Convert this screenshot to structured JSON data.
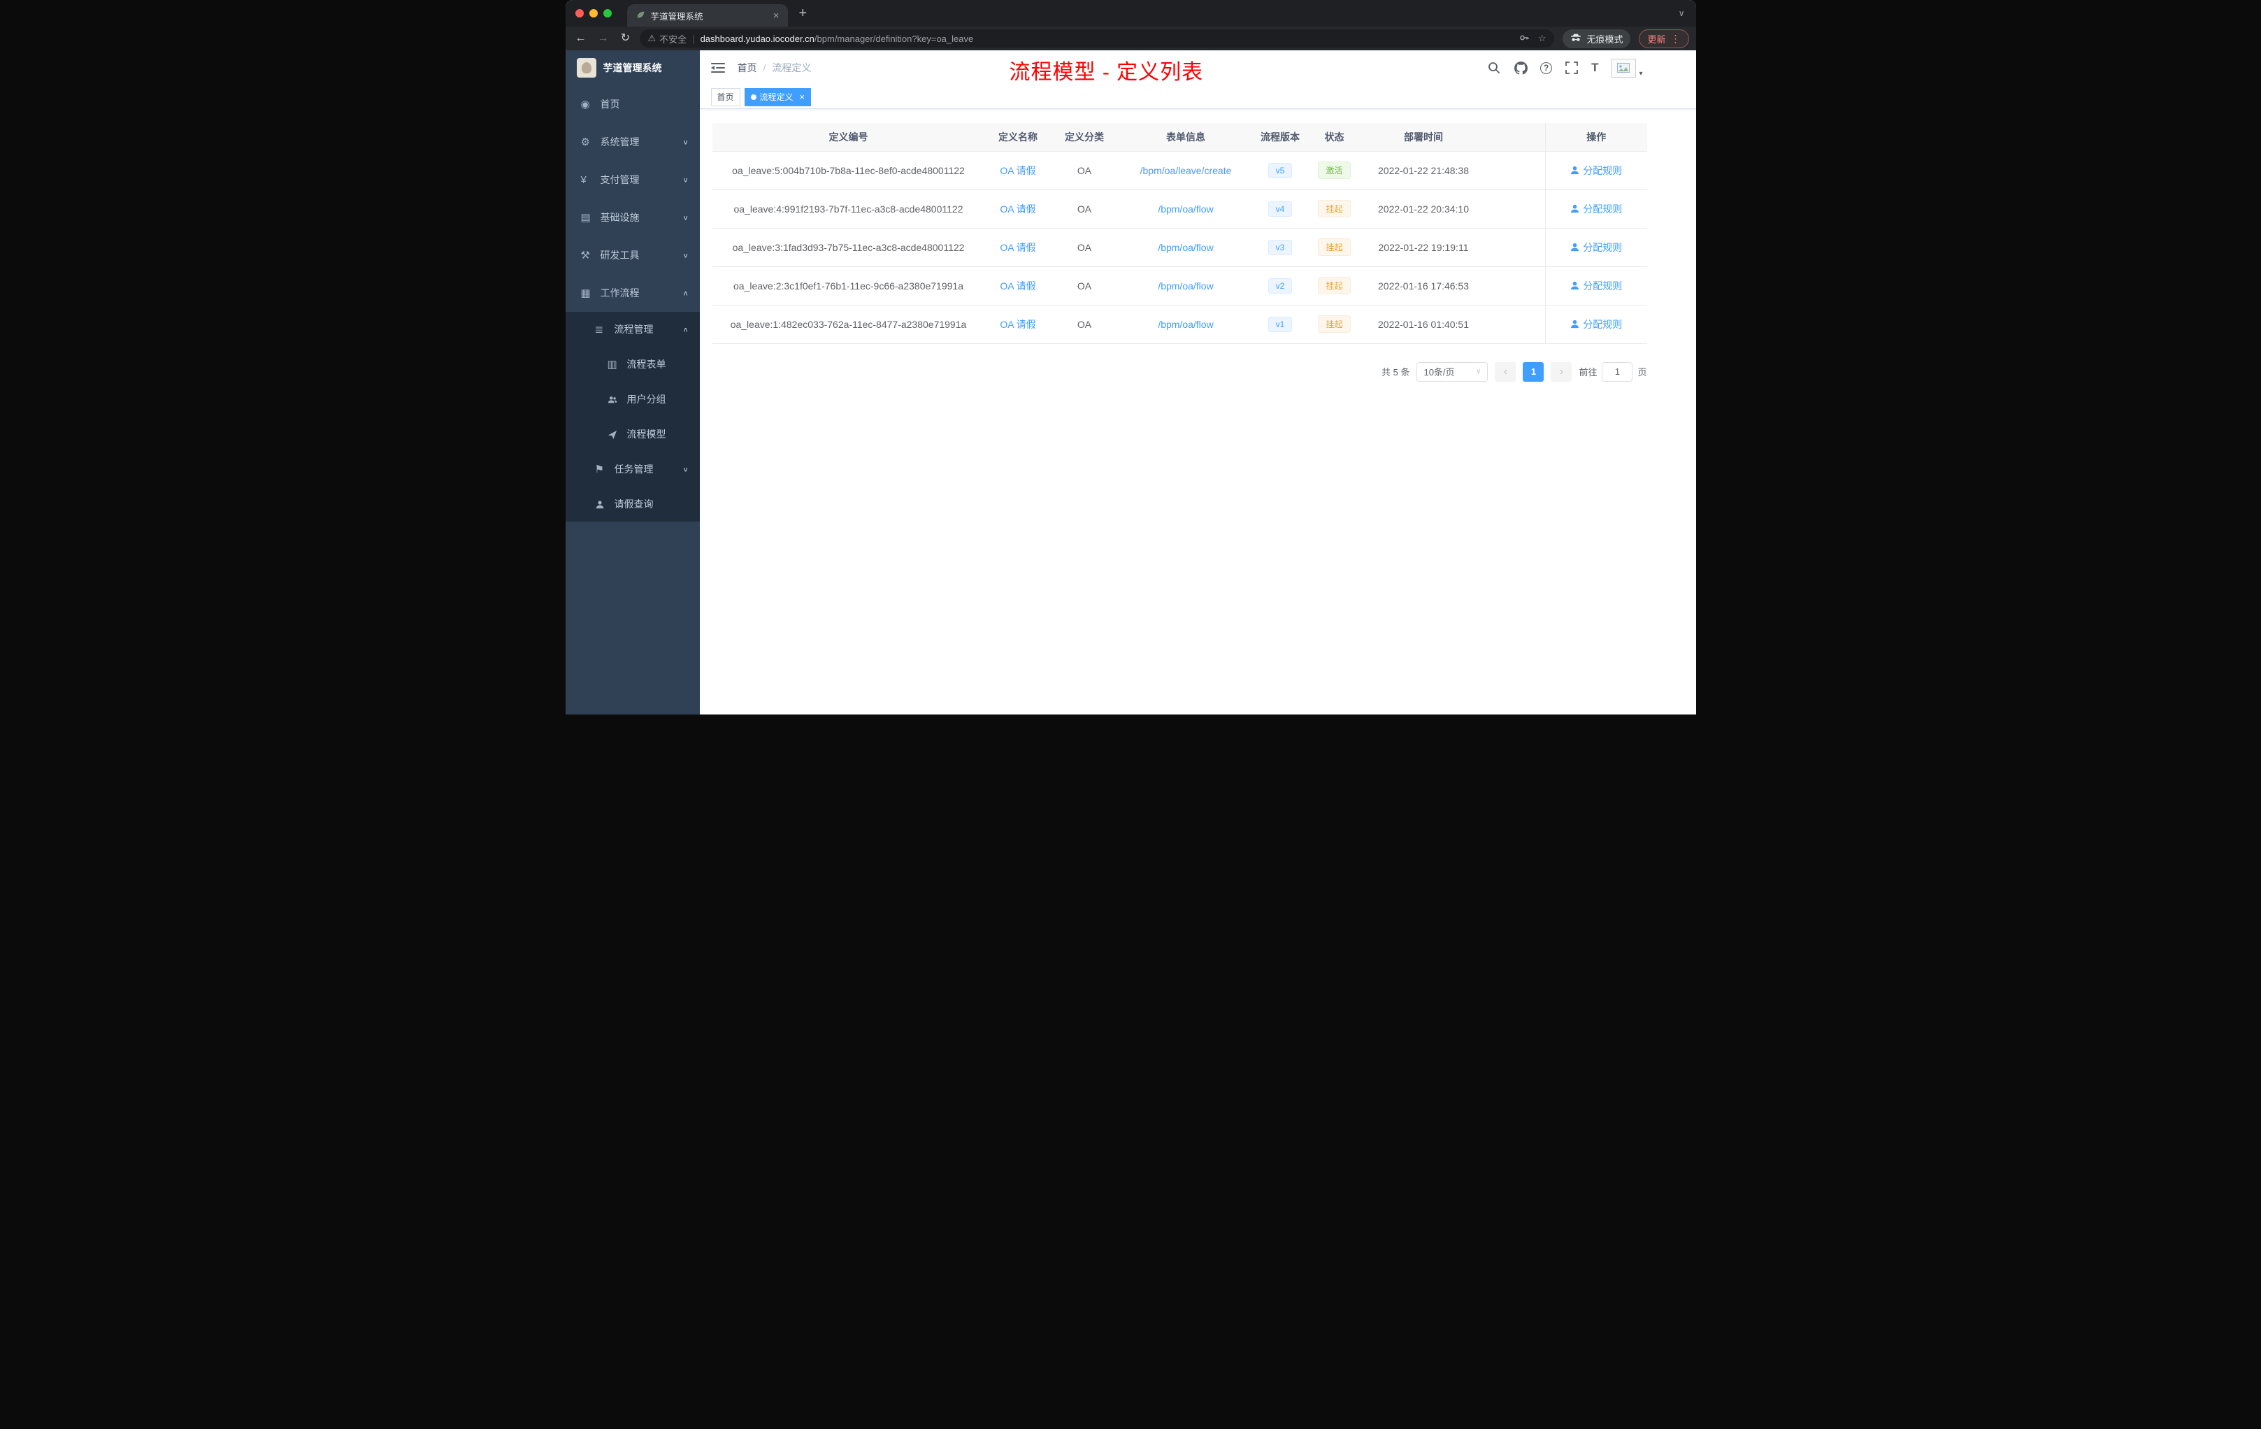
{
  "browser": {
    "tab_title": "芋道管理系统",
    "security_label": "不安全",
    "url_domain": "dashboard.yudao.iocoder.cn",
    "url_path": "/bpm/manager/definition?key=oa_leave",
    "incognito_label": "无痕模式",
    "update_label": "更新"
  },
  "sidebar": {
    "logo_title": "芋道管理系统",
    "menu": [
      {
        "label": "首页"
      },
      {
        "label": "系统管理"
      },
      {
        "label": "支付管理"
      },
      {
        "label": "基础设施"
      },
      {
        "label": "研发工具"
      },
      {
        "label": "工作流程"
      }
    ],
    "submenu": {
      "process_management": {
        "label": "流程管理"
      },
      "children": [
        {
          "label": "流程表单"
        },
        {
          "label": "用户分组"
        },
        {
          "label": "流程模型"
        }
      ],
      "task_management": {
        "label": "任务管理"
      },
      "leave_query": {
        "label": "请假查询"
      }
    }
  },
  "navbar": {
    "breadcrumb": {
      "home": "首页",
      "sep": "/",
      "current": "流程定义"
    },
    "overlay_title": "流程模型 - 定义列表"
  },
  "tags": {
    "home": "首页",
    "active": "流程定义"
  },
  "table": {
    "columns": [
      "定义编号",
      "定义名称",
      "定义分类",
      "表单信息",
      "流程版本",
      "状态",
      "部署时间",
      "操作"
    ],
    "rows": [
      {
        "id": "oa_leave:5:004b710b-7b8a-11ec-8ef0-acde48001122",
        "name": "OA 请假",
        "category": "OA",
        "form": "/bpm/oa/leave/create",
        "version": "v5",
        "status": "激活",
        "time": "2022-01-22 21:48:38",
        "action": "分配规则"
      },
      {
        "id": "oa_leave:4:991f2193-7b7f-11ec-a3c8-acde48001122",
        "name": "OA 请假",
        "category": "OA",
        "form": "/bpm/oa/flow",
        "version": "v4",
        "status": "挂起",
        "time": "2022-01-22 20:34:10",
        "action": "分配规则"
      },
      {
        "id": "oa_leave:3:1fad3d93-7b75-11ec-a3c8-acde48001122",
        "name": "OA 请假",
        "category": "OA",
        "form": "/bpm/oa/flow",
        "version": "v3",
        "status": "挂起",
        "time": "2022-01-22 19:19:11",
        "action": "分配规则"
      },
      {
        "id": "oa_leave:2:3c1f0ef1-76b1-11ec-9c66-a2380e71991a",
        "name": "OA 请假",
        "category": "OA",
        "form": "/bpm/oa/flow",
        "version": "v2",
        "status": "挂起",
        "time": "2022-01-16 17:46:53",
        "action": "分配规则"
      },
      {
        "id": "oa_leave:1:482ec033-762a-11ec-8477-a2380e71991a",
        "name": "OA 请假",
        "category": "OA",
        "form": "/bpm/oa/flow",
        "version": "v1",
        "status": "挂起",
        "time": "2022-01-16 01:40:51",
        "action": "分配规则"
      }
    ]
  },
  "pagination": {
    "total": "共 5 条",
    "page_size": "10条/页",
    "current_page": "1",
    "goto_prefix": "前往",
    "goto_value": "1",
    "goto_suffix": "页"
  },
  "icons": {
    "close": "×",
    "plus": "+",
    "kebab": "⋮",
    "star": "☆",
    "warning_triangle": "⚠",
    "divider": "|",
    "back": "←",
    "forward": "→",
    "reload": "↻",
    "chevron_down": "∨",
    "chevron_up": "∧",
    "caret_down": "▾",
    "tab_caret": "∨",
    "prev": "‹",
    "next": "›",
    "select_caret": "∨",
    "question": "?",
    "font_size": "T",
    "dashboard": "◉",
    "gear": "⚙",
    "yen": "¥",
    "infra": "▤",
    "tools": "⚒",
    "workflow": "▦",
    "process": "≣",
    "form": "▥",
    "flag": "⚑"
  },
  "colors": {
    "accent": "#409eff",
    "success": "#67c23a",
    "warning": "#e6a23c",
    "title_red": "#fe0000",
    "sidebar_bg": "#304156",
    "submenu_bg": "#1f2d3d"
  }
}
